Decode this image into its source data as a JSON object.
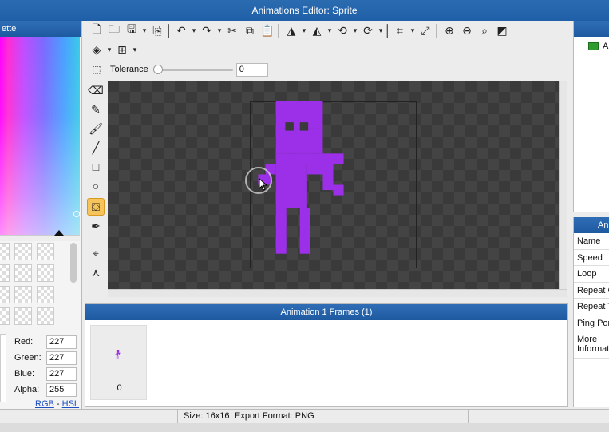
{
  "window": {
    "title": "Animations Editor: Sprite"
  },
  "palette": {
    "header": "ette",
    "swatch_rows": 4,
    "channels": [
      {
        "label": "Red:",
        "value": "227"
      },
      {
        "label": "Green:",
        "value": "227"
      },
      {
        "label": "Blue:",
        "value": "227"
      },
      {
        "label": "Alpha:",
        "value": "255"
      }
    ],
    "mode_links": {
      "rgb": "RGB",
      "separator": "-",
      "hsl": "HSL"
    }
  },
  "toolbar": {
    "row1_icons": [
      "new-file-icon",
      "open-folder-icon",
      "save-icon",
      "export-icon",
      "undo-icon",
      "redo-icon",
      "cut-icon",
      "copy-icon",
      "paste-icon",
      "flip-horizontal-icon",
      "flip-vertical-icon",
      "rotate-ccw-icon",
      "rotate-cw-icon",
      "crop-icon",
      "resize-icon",
      "zoom-in-icon",
      "zoom-out-icon",
      "zoom-fit-icon",
      "toggle-grid-icon"
    ],
    "row2_icons": [
      "layers-icon",
      "grid-icon"
    ],
    "tolerance": {
      "label": "Tolerance",
      "value": "0",
      "slider_level": 0
    }
  },
  "tools": [
    "eraser-icon",
    "pencil-icon",
    "brush-icon",
    "line-icon",
    "rectangle-icon",
    "ellipse-icon",
    "fill-bucket-icon",
    "eyedropper-icon",
    "select-point-icon",
    "nodes-icon"
  ],
  "active_tool": "fill-bucket-icon",
  "sprite": {
    "color": "#9b30e8",
    "grid_size": 16
  },
  "frames_panel": {
    "title": "Animation 1 Frames (1)",
    "frames": [
      {
        "index": "0"
      }
    ]
  },
  "right_top": {
    "header": "",
    "item_label": "A"
  },
  "properties": {
    "header": "An",
    "rows": [
      "Name",
      "Speed",
      "Loop",
      "Repeat C",
      "Repeat T",
      "Ping Por",
      "More Informat"
    ]
  },
  "status": {
    "size": "Size: 16x16",
    "export_format": "Export Format: PNG"
  }
}
